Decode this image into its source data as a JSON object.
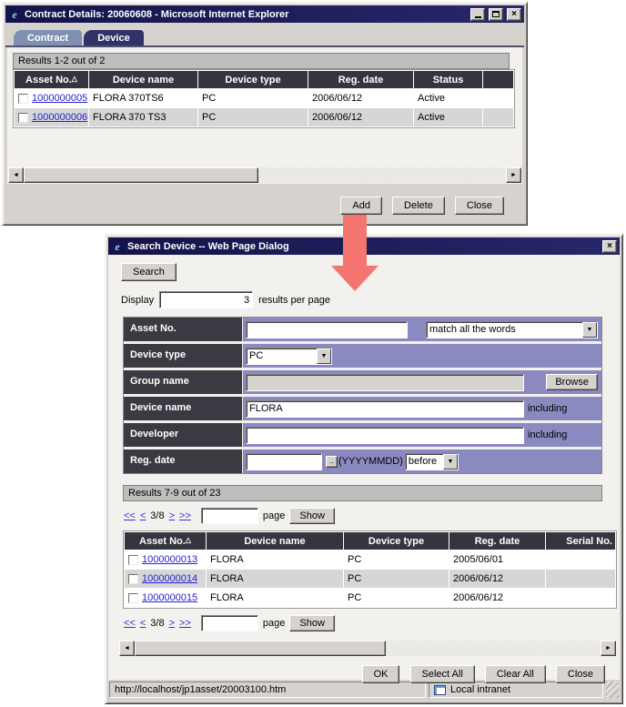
{
  "colors": {
    "title_navy": "#16164d",
    "header_navy": "#35353f",
    "form_purple": "#8a8ac1",
    "link_blue": "#2424cf",
    "arrow_red": "#f4756f",
    "chrome_gray": "#d6d3ce"
  },
  "window1": {
    "title": "Contract Details: 20060608 - Microsoft Internet Explorer",
    "tabs": {
      "contract": "Contract",
      "device": "Device"
    },
    "results_summary": "Results 1-2 out of 2",
    "table": {
      "sort_indicator": "△",
      "headers": [
        "Asset No.",
        "Device name",
        "Device type",
        "Reg. date",
        "Status",
        ""
      ],
      "rows": [
        {
          "asset_no": "1000000005",
          "device_name": "FLORA 370TS6",
          "device_type": "PC",
          "reg_date": "2006/06/12",
          "status": "Active"
        },
        {
          "asset_no": "1000000006",
          "device_name": "FLORA 370 TS3",
          "device_type": "PC",
          "reg_date": "2006/06/12",
          "status": "Active"
        }
      ]
    },
    "buttons": {
      "add": "Add",
      "delete": "Delete",
      "close": "Close"
    }
  },
  "window2": {
    "title": "Search Device -- Web Page Dialog",
    "search_button": "Search",
    "display": {
      "label": "Display",
      "value": "3",
      "suffix": "results per page"
    },
    "form": {
      "asset_no": {
        "label": "Asset No.",
        "value": "",
        "match_select": "match all the words"
      },
      "device_type": {
        "label": "Device type",
        "value": "PC"
      },
      "group_name": {
        "label": "Group name",
        "value": "",
        "browse_button": "Browse"
      },
      "device_name": {
        "label": "Device name",
        "value": "FLORA",
        "note": "including"
      },
      "developer": {
        "label": "Developer",
        "value": "",
        "note": "including"
      },
      "reg_date": {
        "label": "Reg. date",
        "value": "",
        "picker_button": "..",
        "format": "(YYYYMMDD)",
        "when_select": "before"
      }
    },
    "results_summary": "Results 7-9 out of 23",
    "pagination": {
      "first": "<<",
      "prev": "<",
      "current": "3/8",
      "next": ">",
      "last": ">>",
      "page_label": "page",
      "show_button": "Show"
    },
    "table": {
      "sort_indicator": "△",
      "headers": [
        "Asset No.",
        "Device name",
        "Device type",
        "Reg. date",
        "Serial No."
      ],
      "rows": [
        {
          "asset_no": "1000000013",
          "device_name": "FLORA",
          "device_type": "PC",
          "reg_date": "2005/06/01",
          "serial_no": ""
        },
        {
          "asset_no": "1000000014",
          "device_name": "FLORA",
          "device_type": "PC",
          "reg_date": "2006/06/12",
          "serial_no": ""
        },
        {
          "asset_no": "1000000015",
          "device_name": "FLORA",
          "device_type": "PC",
          "reg_date": "2006/06/12",
          "serial_no": ""
        }
      ]
    },
    "buttons": {
      "ok": "OK",
      "select_all": "Select All",
      "clear_all": "Clear All",
      "close": "Close"
    },
    "statusbar": {
      "url": "http://localhost/jp1asset/20003100.htm",
      "zone": "Local intranet"
    }
  }
}
